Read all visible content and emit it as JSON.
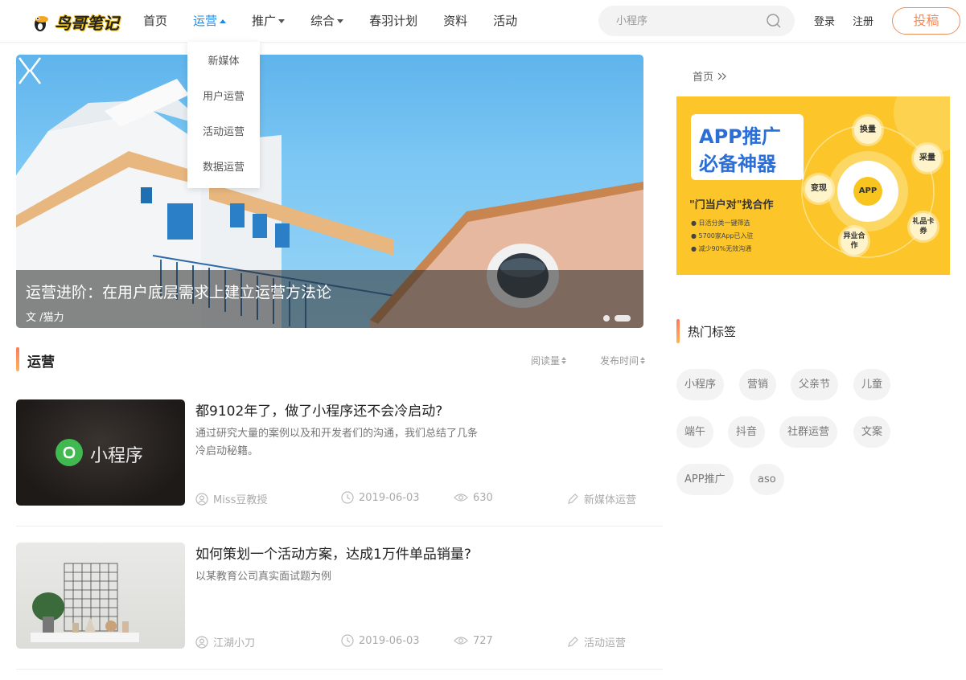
{
  "header": {
    "logo_text": "鸟哥笔记",
    "nav": [
      {
        "label": "首页"
      },
      {
        "label": "运营",
        "active": true,
        "caret": "up"
      },
      {
        "label": "推广",
        "caret": "down"
      },
      {
        "label": "综合",
        "caret": "down"
      },
      {
        "label": "春羽计划"
      },
      {
        "label": "资料"
      },
      {
        "label": "活动"
      }
    ],
    "dropdown": [
      "新媒体",
      "用户运营",
      "活动运营",
      "数据运营"
    ],
    "search": {
      "placeholder": "小程序"
    },
    "login": "登录",
    "register": "注册",
    "submit": "投稿"
  },
  "banner": {
    "title": "运营进阶：在用户底层需求上建立运营方法论",
    "author": "文 /猫力",
    "slides": 2,
    "active_slide": 1
  },
  "section": {
    "title": "运营",
    "sort_read": "阅读量",
    "sort_time": "发布时间"
  },
  "articles": [
    {
      "title": "都9102年了，做了小程序还不会冷启动?",
      "desc": "通过研究大量的案例以及和开发者们的沟通，我们总结了几条冷启动秘籍。",
      "thumb_text": "小程序",
      "author": "Miss豆教授",
      "date": "2019-06-03",
      "views": "630",
      "category": "新媒体运营"
    },
    {
      "title": "如何策划一个活动方案，达成1万件单品销量?",
      "desc": "以某教育公司真实面试题为例",
      "author": "江湖小刀",
      "date": "2019-06-03",
      "views": "727",
      "category": "活动运营"
    }
  ],
  "sidebar": {
    "breadcrumb": "首页",
    "ad": {
      "line1": "APP推广",
      "line2": "必备神器",
      "sub": "\"门当户对\"找合作",
      "bullets": [
        "日活分类一键筛选",
        "5700家App已入驻",
        "减少90%无效沟通"
      ],
      "bubbles": [
        "换量",
        "采量",
        "变现",
        "礼品卡券",
        "异业合作"
      ],
      "center": "APP"
    },
    "hot_title": "热门标签",
    "tags": [
      "小程序",
      "营销",
      "父亲节",
      "儿童",
      "端午",
      "抖音",
      "社群运营",
      "文案",
      "APP推广",
      "aso"
    ]
  },
  "colors": {
    "accent": "#1e88e5",
    "submit": "#f08c5a",
    "ad_bg": "#fcc62a"
  }
}
